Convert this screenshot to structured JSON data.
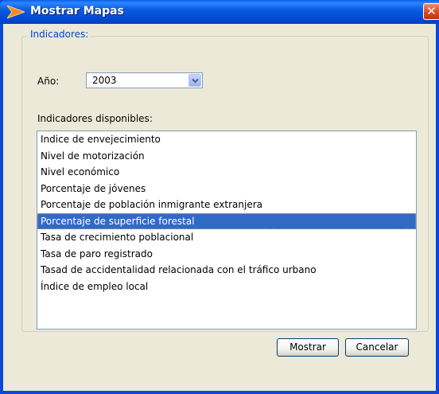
{
  "window": {
    "title": "Mostrar Mapas",
    "close_symbol": "✕"
  },
  "group": {
    "legend": "Indicadores:"
  },
  "year": {
    "label": "Año:",
    "value": "2003"
  },
  "indicators": {
    "label": "Indicadores disponibles:",
    "items": [
      "Indice de envejecimiento",
      "Nivel de motorización",
      "Nivel económico",
      "Porcentaje de jóvenes",
      "Porcentaje de población inmigrante extranjera",
      "Porcentaje de superficie forestal",
      "Tasa de crecimiento poblacional",
      "Tasa de paro registrado",
      "Tasad de accidentalidad relacionada con el tráfico urbano",
      "Índice de empleo local"
    ],
    "selected": "Porcentaje de superficie forestal"
  },
  "buttons": {
    "ok": "Mostrar",
    "cancel": "Cancelar"
  },
  "colors": {
    "titlebar": "#0a5ce0",
    "selection": "#316ac5",
    "legend_text": "#0046d5",
    "close_button": "#d8471c"
  },
  "icons": {
    "app": "arrow-logo-icon",
    "close": "close-icon",
    "dropdown": "chevron-down-icon"
  }
}
